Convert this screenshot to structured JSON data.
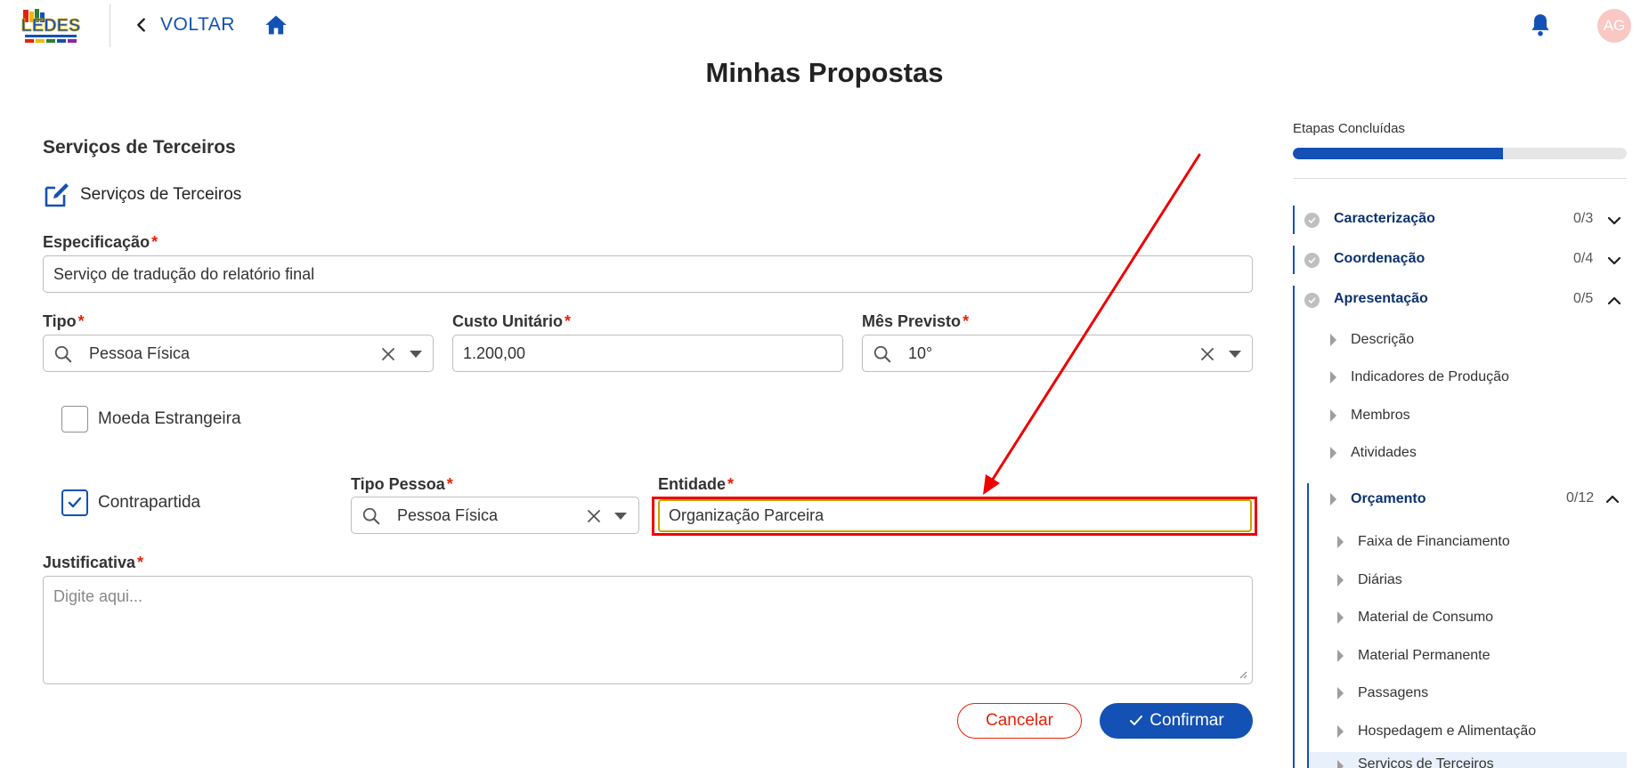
{
  "header": {
    "logo_text": "LEDES",
    "back_label": "VOLTAR",
    "avatar_initials": "AG"
  },
  "page": {
    "title": "Minhas Propostas"
  },
  "form": {
    "section_title": "Serviços de Terceiros",
    "subsection_title": "Serviços de Terceiros",
    "especificacao": {
      "label": "Especificação",
      "required": "*",
      "value": "Serviço de tradução do relatório final"
    },
    "tipo": {
      "label": "Tipo",
      "required": "*",
      "value": "Pessoa Física"
    },
    "custo_unitario": {
      "label": "Custo Unitário",
      "required": "*",
      "value": "1.200,00"
    },
    "mes_previsto": {
      "label": "Mês Previsto",
      "required": "*",
      "value": "10°"
    },
    "moeda_estrangeira": {
      "label": "Moeda Estrangeira",
      "checked": false
    },
    "contrapartida": {
      "label": "Contrapartida",
      "checked": true
    },
    "tipo_pessoa": {
      "label": "Tipo Pessoa",
      "required": "*",
      "value": "Pessoa Física"
    },
    "entidade": {
      "label": "Entidade",
      "required": "*",
      "value": "Organização Parceira"
    },
    "justificativa": {
      "label": "Justificativa",
      "required": "*",
      "placeholder": "Digite aqui..."
    },
    "cancel_label": "Cancelar",
    "confirm_label": "Confirmar"
  },
  "progress": {
    "title": "Etapas Concluídas",
    "fraction": 0.63
  },
  "steps": [
    {
      "label": "Caracterização",
      "count": "0/3",
      "expanded": false
    },
    {
      "label": "Coordenação",
      "count": "0/4",
      "expanded": false
    },
    {
      "label": "Apresentação",
      "count": "0/5",
      "expanded": true
    }
  ],
  "apresentacao_items": [
    "Descrição",
    "Indicadores de Produção",
    "Membros",
    "Atividades"
  ],
  "orcamento": {
    "label": "Orçamento",
    "count": "0/12",
    "items": [
      "Faixa de Financiamento",
      "Diárias",
      "Material de Consumo",
      "Material Permanente",
      "Passagens",
      "Hospedagem e Alimentação",
      "Serviços de Terceiros"
    ]
  },
  "colors": {
    "primary": "#1351b4",
    "danger": "#e52207",
    "annotation_red": "#ee0000",
    "focus_border": "#c8a200"
  }
}
